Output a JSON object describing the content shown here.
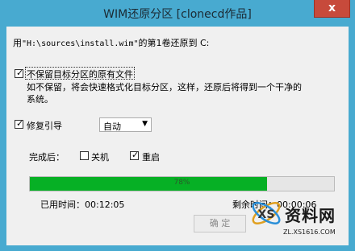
{
  "window": {
    "title": "WIM还原分区  [clonecd作品]",
    "close_glyph": "x"
  },
  "message": {
    "prefix": "用",
    "path": "\"H:\\sources\\install.wim\"",
    "suffix": "的第1卷还原到 C:"
  },
  "options": {
    "keep_files": {
      "label": "不保留目标分区的原有文件",
      "checked": true
    },
    "keep_files_desc_line1": "如不保留，将会快速格式化目标分区，这样，还原后将得到一个干净的",
    "keep_files_desc_line2": "系统。",
    "repair_boot": {
      "label": "修复引导",
      "checked": true
    },
    "repair_mode": {
      "selected": "自动"
    }
  },
  "after_complete": {
    "label": "完成后：",
    "shutdown": {
      "label": "关机",
      "checked": false
    },
    "restart": {
      "label": "重启",
      "checked": true
    }
  },
  "progress": {
    "percent_text": "78%",
    "fraction": 0.78
  },
  "elapsed": {
    "label": "已用时间：",
    "value": "00:12:05"
  },
  "remaining": {
    "label": "剩余时间：",
    "value": "00:00:06"
  },
  "buttons": {
    "ok": "确 定"
  },
  "watermark": {
    "brand": "资料网",
    "url": "ZL.XS1616.COM"
  },
  "colors": {
    "title_bar": "#48aad0",
    "close_button": "#c74a3b",
    "progress_fill": "#06b025"
  }
}
